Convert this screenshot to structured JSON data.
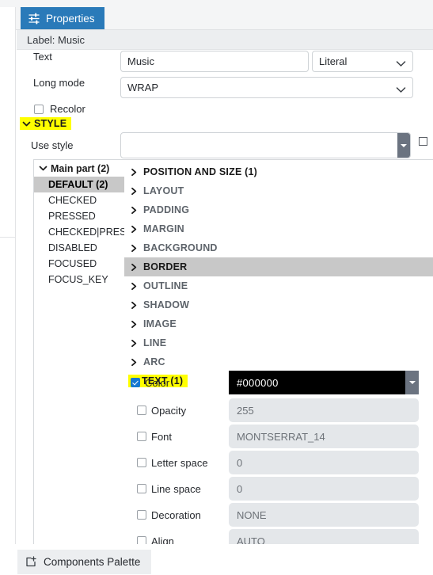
{
  "window": {
    "restore_icon": "restore-window-icon"
  },
  "tab": {
    "label": "Properties",
    "icon": "sliders-icon"
  },
  "header": {
    "label": "Label: Music"
  },
  "form": {
    "text": {
      "label": "Text",
      "value": "Music",
      "mode": "Literal"
    },
    "long_mode": {
      "label": "Long mode",
      "value": "WRAP"
    },
    "recolor": {
      "label": "Recolor",
      "checked": false
    }
  },
  "style_section": {
    "label": "STYLE",
    "expanded": true,
    "use_style": {
      "label": "Use style",
      "value": ""
    }
  },
  "parts": {
    "group": {
      "label": "Main part (2)",
      "expanded": true
    },
    "states": [
      {
        "label": "DEFAULT (2)",
        "selected": true
      },
      {
        "label": "CHECKED",
        "selected": false
      },
      {
        "label": "PRESSED",
        "selected": false
      },
      {
        "label": "CHECKED|PRESSED",
        "selected": false
      },
      {
        "label": "DISABLED",
        "selected": false
      },
      {
        "label": "FOCUSED",
        "selected": false
      },
      {
        "label": "FOCUS_KEY",
        "selected": false
      }
    ]
  },
  "property_groups": [
    {
      "label": "POSITION AND SIZE (1)",
      "expanded": false,
      "highlighted": false,
      "bold": true
    },
    {
      "label": "LAYOUT",
      "expanded": false,
      "highlighted": false,
      "bold": false
    },
    {
      "label": "PADDING",
      "expanded": false,
      "highlighted": false,
      "bold": false
    },
    {
      "label": "MARGIN",
      "expanded": false,
      "highlighted": false,
      "bold": false
    },
    {
      "label": "BACKGROUND",
      "expanded": false,
      "highlighted": false,
      "bold": false
    },
    {
      "label": "BORDER",
      "expanded": false,
      "highlighted": true,
      "bold": false
    },
    {
      "label": "OUTLINE",
      "expanded": false,
      "highlighted": false,
      "bold": false
    },
    {
      "label": "SHADOW",
      "expanded": false,
      "highlighted": false,
      "bold": false
    },
    {
      "label": "IMAGE",
      "expanded": false,
      "highlighted": false,
      "bold": false
    },
    {
      "label": "LINE",
      "expanded": false,
      "highlighted": false,
      "bold": false
    },
    {
      "label": "ARC",
      "expanded": false,
      "highlighted": false,
      "bold": false
    }
  ],
  "text_section": {
    "label": "TEXT (1)",
    "expanded": true,
    "properties": [
      {
        "label": "Color",
        "value": "#000000",
        "checked": true
      },
      {
        "label": "Opacity",
        "value": "255",
        "checked": false
      },
      {
        "label": "Font",
        "value": "MONTSERRAT_14",
        "checked": false
      },
      {
        "label": "Letter space",
        "value": "0",
        "checked": false
      },
      {
        "label": "Line space",
        "value": "0",
        "checked": false
      },
      {
        "label": "Decoration",
        "value": "NONE",
        "checked": false
      },
      {
        "label": "Align",
        "value": "AUTO",
        "checked": false
      }
    ]
  },
  "bottom": {
    "palette_label": "Components Palette",
    "palette_icon": "add-panel-icon"
  },
  "colors": {
    "accent": "#2a7ab9",
    "highlight": "#ffff00",
    "selection": "#c8c8c8",
    "field_bg": "#e4e7ea",
    "text_color_value": "#000000"
  }
}
